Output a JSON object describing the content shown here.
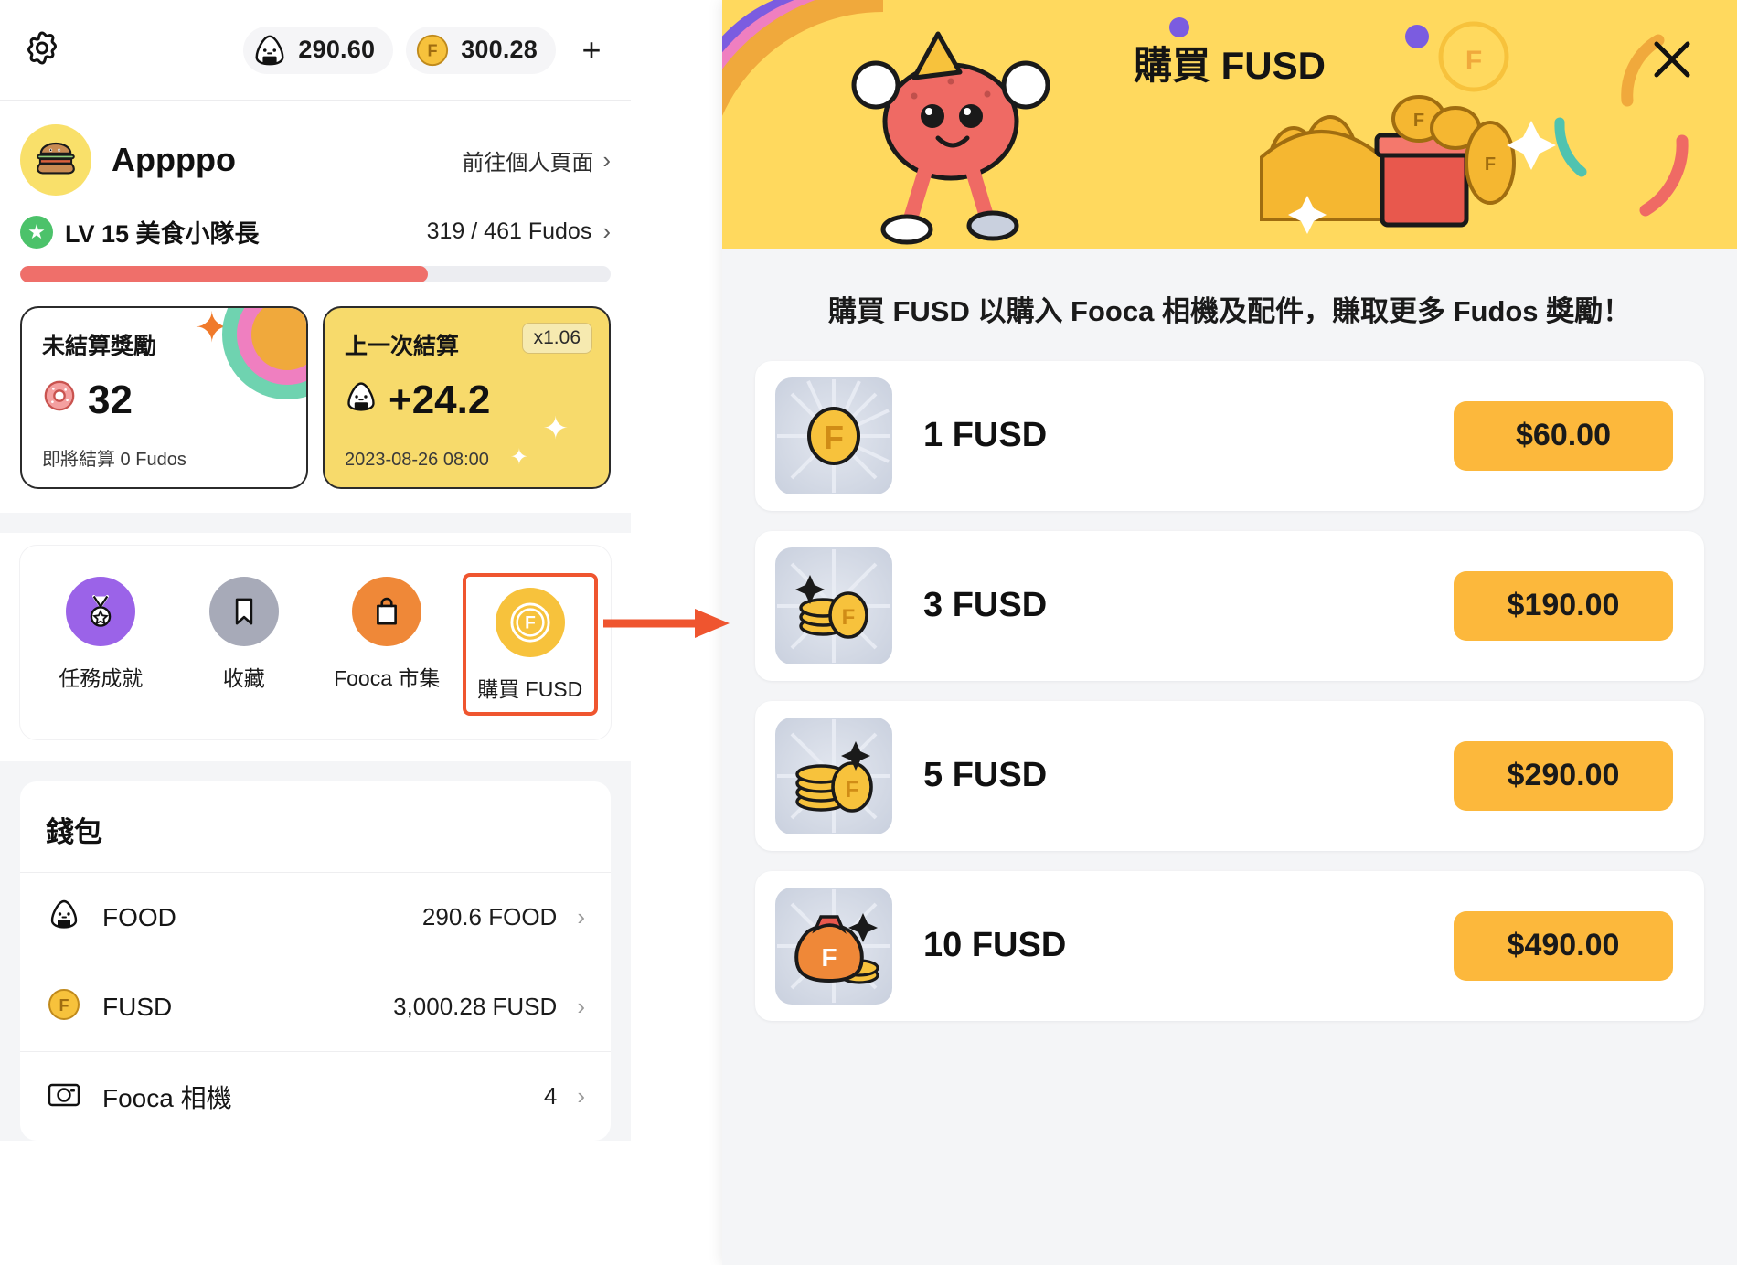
{
  "left": {
    "topbar": {
      "settings_icon": "gear-icon",
      "balances": [
        {
          "icon": "onigiri-icon",
          "value": "290.60"
        },
        {
          "icon": "fusd-coin-icon",
          "value": "300.28"
        }
      ],
      "add_label": "+"
    },
    "profile": {
      "avatar_icon": "burger-avatar",
      "username": "Appppo",
      "goto_label": "前往個人頁面",
      "chevron": "›"
    },
    "level": {
      "badge_icon": "star-icon",
      "text": "LV 15 美食小隊長",
      "progress_text": "319 / 461 Fudos",
      "chevron": "›",
      "progress_percent": 69
    },
    "cards": [
      {
        "title": "未結算獎勵",
        "icon": "donut-icon",
        "value": "32",
        "sub": "即將結算 0 Fudos",
        "style": "white"
      },
      {
        "title": "上一次結算",
        "icon": "onigiri-icon",
        "value": "+24.2",
        "sub": "2023-08-26 08:00",
        "badge": "x1.06",
        "style": "yellow"
      }
    ],
    "menu": [
      {
        "label": "任務成就",
        "icon": "medal-icon",
        "color": "#9b63e8",
        "highlight": false
      },
      {
        "label": "收藏",
        "icon": "bookmark-icon",
        "color": "#a7aab8",
        "highlight": false
      },
      {
        "label": "Fooca 市集",
        "icon": "shopping-bag-icon",
        "color": "#ef8838",
        "highlight": false
      },
      {
        "label": "購買 FUSD",
        "icon": "fusd-coin-icon",
        "color": "#f7c23c",
        "highlight": true
      }
    ],
    "wallet": {
      "title": "錢包",
      "rows": [
        {
          "icon": "onigiri-icon",
          "name": "FOOD",
          "value": "290.6 FOOD",
          "chevron": "›"
        },
        {
          "icon": "fusd-coin-icon",
          "name": "FUSD",
          "value": "3,000.28 FUSD",
          "chevron": "›"
        },
        {
          "icon": "camera-icon",
          "name": "Fooca 相機",
          "value": "4",
          "chevron": "›"
        }
      ]
    }
  },
  "right": {
    "hero": {
      "title": "購買 FUSD",
      "close_icon": "close-icon"
    },
    "description": "購買 FUSD 以購入 Fooca 相機及配件，賺取更多 Fudos 獎勵！",
    "packs": [
      {
        "icon": "single-coin-icon",
        "name": "1 FUSD",
        "price": "$60.00"
      },
      {
        "icon": "coin-stack-icon",
        "name": "3 FUSD",
        "price": "$190.00"
      },
      {
        "icon": "coin-pile-icon",
        "name": "5 FUSD",
        "price": "$290.00"
      },
      {
        "icon": "coin-bag-icon",
        "name": "10 FUSD",
        "price": "$490.00"
      }
    ]
  },
  "annotation": {
    "arrow_color": "#ef552f",
    "highlight_color": "#ef552f"
  }
}
